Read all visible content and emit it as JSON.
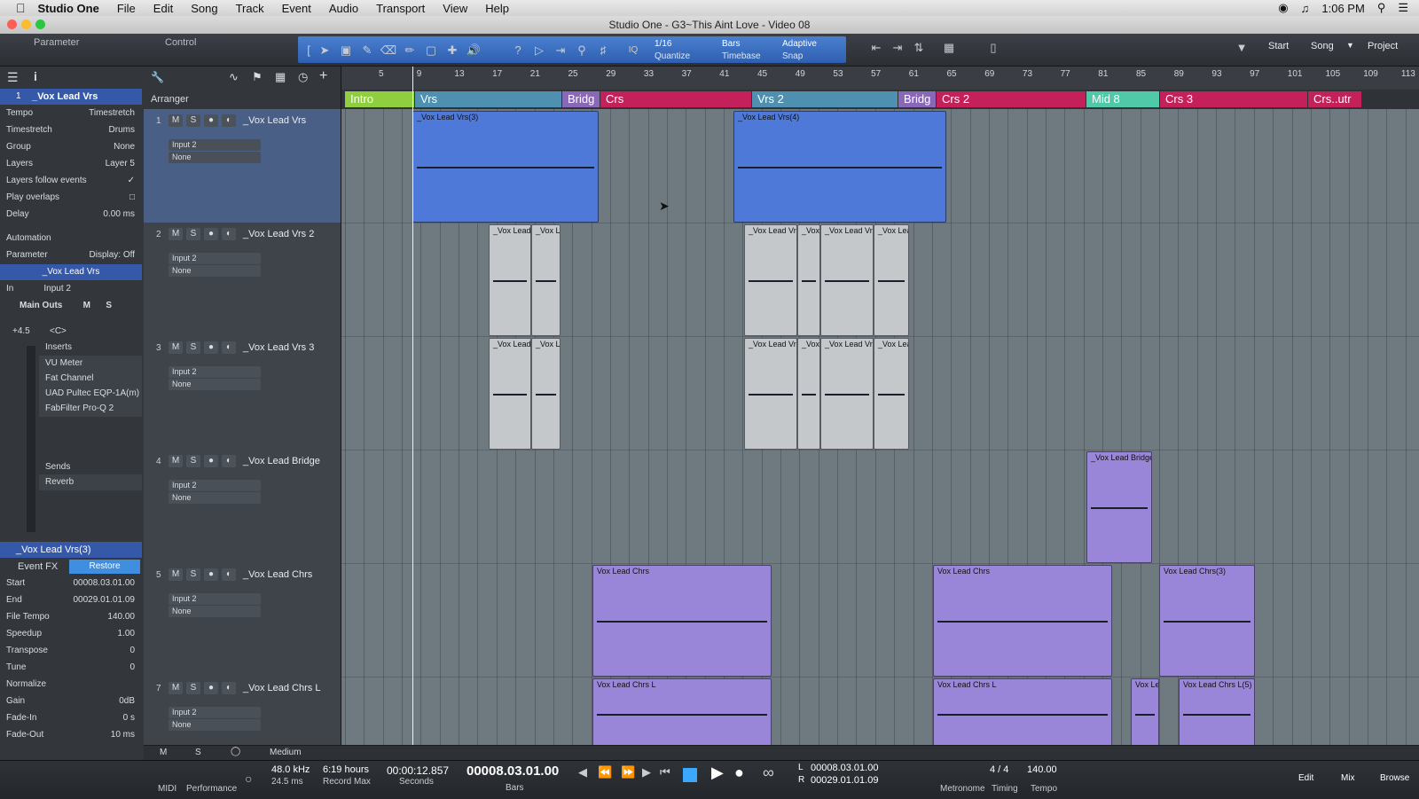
{
  "menubar": {
    "app": "Studio One",
    "items": [
      "File",
      "Edit",
      "Song",
      "Track",
      "Event",
      "Audio",
      "Transport",
      "View",
      "Help"
    ],
    "clock": "1:06 PM"
  },
  "window": {
    "title": "Studio One - G3~This Aint Love - Video 08"
  },
  "toolbar": {
    "parameter_label": "Parameter",
    "control_label": "Control",
    "quantize_value": "1/16",
    "quantize_label": "Quantize",
    "timebase_value": "Bars",
    "timebase_label": "Timebase",
    "snap_value": "Adaptive",
    "snap_label": "Snap",
    "iq_label": "IQ",
    "start_label": "Start",
    "song_label": "Song",
    "project_label": "Project"
  },
  "inspector": {
    "track_number": "1",
    "track_name": "_Vox Lead Vrs",
    "rows": [
      {
        "k": "Tempo",
        "v": "Timestretch"
      },
      {
        "k": "Timestretch",
        "v": "Drums"
      },
      {
        "k": "Group",
        "v": "None"
      },
      {
        "k": "Layers",
        "v": "Layer 5"
      },
      {
        "k": "Layers follow events",
        "v": ""
      },
      {
        "k": "Play overlaps",
        "v": ""
      },
      {
        "k": "Delay",
        "v": "0.00 ms"
      }
    ],
    "automation_label": "Automation",
    "parameter_label": "Parameter",
    "display_label": "Display: Off",
    "channel_name": "_Vox Lead Vrs",
    "in_label": "In",
    "in_value": "Input 2",
    "main_outs": "Main Outs",
    "m_label": "M",
    "s_label": "S",
    "gain_value": "+4.5",
    "pan_value": "<C>",
    "inserts_label": "Inserts",
    "inserts": [
      "VU Meter",
      "Fat Channel",
      "UAD Pultec EQP-1A(m)",
      "FabFilter Pro-Q 2"
    ],
    "sends_label": "Sends",
    "sends": [
      "Reverb"
    ],
    "event_name": "_Vox Lead Vrs(3)",
    "event_fx_label": "Event FX",
    "restore_label": "Restore",
    "event_rows": [
      {
        "k": "Start",
        "v": "00008.03.01.00"
      },
      {
        "k": "End",
        "v": "00029.01.01.09"
      },
      {
        "k": "File Tempo",
        "v": "140.00"
      },
      {
        "k": "Speedup",
        "v": "1.00"
      },
      {
        "k": "Transpose",
        "v": "0"
      },
      {
        "k": "Tune",
        "v": "0"
      },
      {
        "k": "Normalize",
        "v": ""
      },
      {
        "k": "Gain",
        "v": "0dB"
      },
      {
        "k": "Fade-In",
        "v": "0 s"
      },
      {
        "k": "Fade-Out",
        "v": "10 ms"
      }
    ]
  },
  "arranger_label": "Arranger",
  "ruler_bars": [
    "5",
    "9",
    "13",
    "17",
    "21",
    "25",
    "29",
    "33",
    "37",
    "41",
    "45",
    "49",
    "53",
    "57",
    "61",
    "65",
    "69",
    "73",
    "77",
    "81",
    "85",
    "89",
    "93",
    "97",
    "101",
    "105",
    "109",
    "113"
  ],
  "sections": [
    {
      "label": "Intro",
      "color": "#8fcf3f"
    },
    {
      "label": "Vrs",
      "color": "#4f8fb0"
    },
    {
      "label": "Bridg",
      "color": "#8a68b8"
    },
    {
      "label": "Crs",
      "color": "#c4205a"
    },
    {
      "label": "Vrs 2",
      "color": "#4f8fb0"
    },
    {
      "label": "Bridg",
      "color": "#8a68b8"
    },
    {
      "label": "Crs 2",
      "color": "#c4205a"
    },
    {
      "label": "Mid 8",
      "color": "#4fc9a8"
    },
    {
      "label": "Crs 3",
      "color": "#c4205a"
    },
    {
      "label": "Crs..utr",
      "color": "#c4205a"
    }
  ],
  "tracks": [
    {
      "num": "1",
      "name": "_Vox Lead Vrs",
      "input": "Input 2",
      "output": "None"
    },
    {
      "num": "2",
      "name": "_Vox Lead Vrs 2",
      "input": "Input 2",
      "output": "None"
    },
    {
      "num": "3",
      "name": "_Vox Lead Vrs 3",
      "input": "Input 2",
      "output": "None"
    },
    {
      "num": "4",
      "name": "_Vox Lead Bridge",
      "input": "Input 2",
      "output": "None"
    },
    {
      "num": "5",
      "name": "_Vox Lead Chrs",
      "input": "Input 2",
      "output": "None"
    },
    {
      "num": "7",
      "name": "_Vox Lead Chrs L",
      "input": "Input 2",
      "output": "None"
    }
  ],
  "clips": [
    {
      "label": "_Vox Lead Vrs(3)"
    },
    {
      "label": "_Vox Lead Vrs(4)"
    },
    {
      "label": "_Vox Lead V"
    },
    {
      "label": "_Vox Le"
    },
    {
      "label": "_Vox Lead Vrs"
    },
    {
      "label": "_Vox Lead Bridge"
    },
    {
      "label": "Vox Lead Chrs"
    },
    {
      "label": "Vox Lead Chrs(3)"
    },
    {
      "label": "Vox Lead Chrs L"
    },
    {
      "label": "Vox Lead Chrs L(5)"
    },
    {
      "label": "Vox Le"
    }
  ],
  "footer": {
    "zoom": "Medium",
    "m": "M",
    "s": "S"
  },
  "transport": {
    "midi_label": "MIDI",
    "performance_label": "Performance",
    "sample_rate": "48.0 kHz",
    "latency": "24.5 ms",
    "record_time": "6:19 hours",
    "record_max_label": "Record Max",
    "seconds_value": "00:00:12.857",
    "seconds_label": "Seconds",
    "bars_value": "00008.03.01.00",
    "bars_label": "Bars",
    "loop_left": "00008.03.01.00",
    "loop_right": "00029.01.01.09",
    "l_label": "L",
    "r_label": "R",
    "metronome_label": "Metronome",
    "timing_value": "4 / 4",
    "timing_label": "Timing",
    "tempo_value": "140.00",
    "tempo_label": "Tempo",
    "edit_label": "Edit",
    "mix_label": "Mix",
    "browse_label": "Browse"
  },
  "colors": {
    "accent": "#3559a8",
    "clip_blue": "#4e79d8",
    "clip_purple": "#9a86d8",
    "clip_gray": "#c4c8cb"
  }
}
